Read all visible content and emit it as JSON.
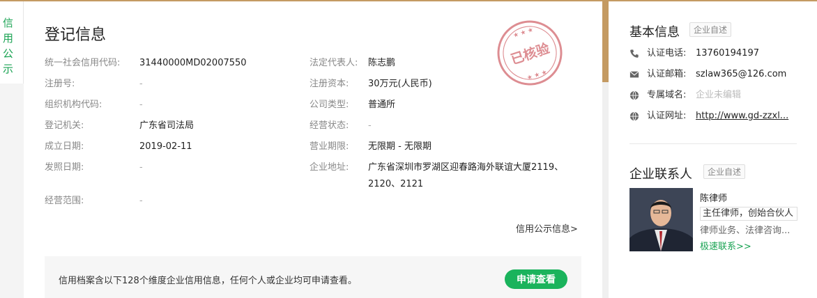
{
  "side_tab": {
    "label": "信用公示",
    "color": "#1aa353"
  },
  "registration": {
    "title": "登记信息",
    "stamp_text": "已核验",
    "left": [
      {
        "label": "统一社会信用代码:",
        "value": "31440000MD02007550"
      },
      {
        "label": "注册号:",
        "value": "-"
      },
      {
        "label": "组织机构代码:",
        "value": "-"
      },
      {
        "label": "登记机关:",
        "value": "广东省司法局"
      },
      {
        "label": "成立日期:",
        "value": "2019-02-11"
      },
      {
        "label": "发照日期:",
        "value": "-"
      },
      {
        "label": "经营范围:",
        "value": "-"
      }
    ],
    "right": [
      {
        "label": "法定代表人:",
        "value": "陈志鹏"
      },
      {
        "label": "注册资本:",
        "value": "30万元(人民币)"
      },
      {
        "label": "公司类型:",
        "value": "普通所"
      },
      {
        "label": "经营状态:",
        "value": "-"
      },
      {
        "label": "营业期限:",
        "value": "无限期 - 无限期"
      },
      {
        "label": "企业地址:",
        "value_line1": "广东省深圳市罗湖区迎春路海外联谊大厦2119、",
        "value_line2": "2120、2121"
      }
    ],
    "credit_link": "信用公示信息>"
  },
  "banner": {
    "text": "信用档案含以下128个维度企业信用信息，任何个人或企业均可申请查看。",
    "button": "申请查看",
    "button_color": "#1ab35c"
  },
  "basic_info": {
    "title": "基本信息",
    "tag": "企业自述",
    "rows": [
      {
        "icon": "phone-icon",
        "label": "认证电话:",
        "value": "13760194197"
      },
      {
        "icon": "mail-icon",
        "label": "认证邮箱:",
        "value": "szlaw365@126.com"
      },
      {
        "icon": "globe-icon",
        "label": "专属域名:",
        "value": "企业未编辑"
      },
      {
        "icon": "globe-icon",
        "label": "认证网址:",
        "value": "http://www.gd-zzxl..."
      }
    ]
  },
  "contact": {
    "title": "企业联系人",
    "tag": "企业自述",
    "name": "陈律师",
    "role": "主任律师，创始合伙人",
    "business": "律师业务、法律咨询...",
    "quick_contact": "极速联系>>"
  },
  "colors": {
    "accent_gold": "#c49a62",
    "green": "#1aa353",
    "stamp_red": "#c8424a"
  }
}
